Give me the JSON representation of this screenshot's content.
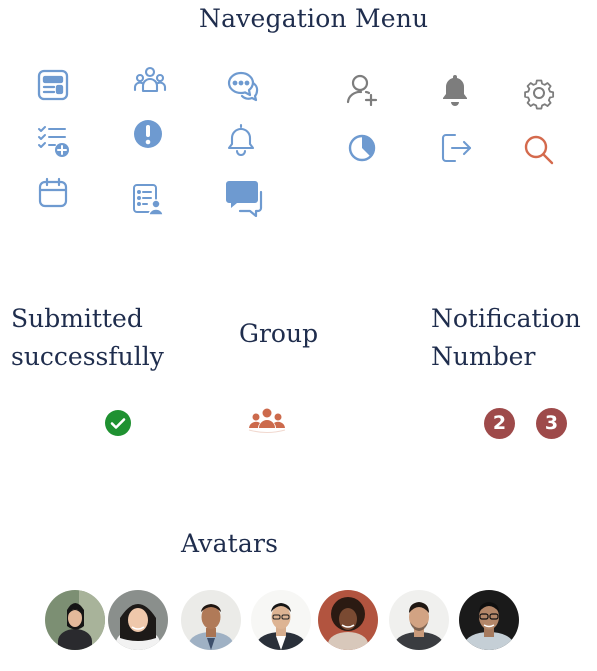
{
  "nav_title": "Navegation  Menu",
  "sections": {
    "submitted": [
      "Submitted",
      "successfully"
    ],
    "group": "Group",
    "notification": [
      "Notification",
      "Number"
    ],
    "avatars": "Avatars"
  },
  "notification_numbers": [
    "2",
    "3"
  ],
  "icons": [
    "dashboard-icon",
    "users-icon",
    "chat-icon",
    "add-user-icon",
    "bell-filled-icon",
    "settings-icon",
    "task-list-add-icon",
    "alert-icon",
    "bell-outline-icon",
    "pie-chart-icon",
    "logout-icon",
    "search-icon",
    "calendar-icon",
    "user-report-icon",
    "chat-reply-icon"
  ],
  "colors": {
    "icon_blue": "#6e9ad0",
    "icon_gray": "#7d7d7d",
    "search_orange": "#d46a4d",
    "success_green": "#1f9131",
    "group_orange": "#cc6a4c",
    "badge_red": "#9e4a4a",
    "text_navy": "#1f2d4d"
  }
}
